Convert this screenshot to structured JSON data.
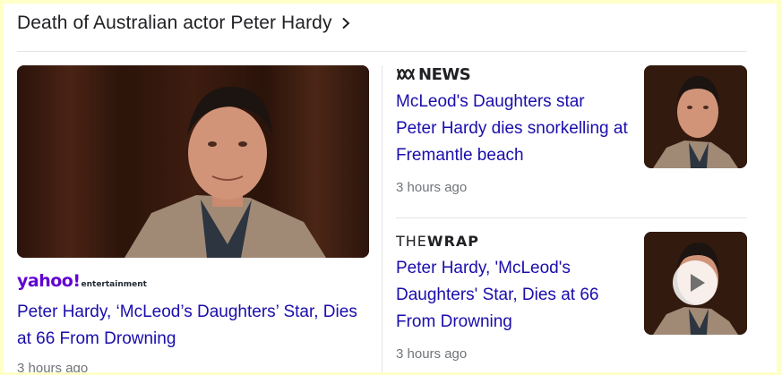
{
  "header": {
    "title": "Death of Australian actor Peter Hardy",
    "chevron_icon": "chevron-right-icon"
  },
  "stories": {
    "main": {
      "source_logo_name": "yahoo-entertainment-logo",
      "source_word": "yahoo!",
      "source_sub": "entertainment",
      "headline": "Peter Hardy, ‘McLeod’s Daughters’ Star, Dies at 66 From Drowning",
      "time": "3 hours ago",
      "image": "peter-hardy-photo"
    },
    "side": [
      {
        "source_logo_name": "abc-news-logo",
        "source_word": "NEWS",
        "headline": "McLeod's Daughters star Peter Hardy dies snorkelling at Fremantle beach",
        "time": "3 hours ago",
        "image": "peter-hardy-thumbnail"
      },
      {
        "source_logo_name": "the-wrap-logo",
        "source_the": "THE",
        "source_wrap": "WRAP",
        "headline": "Peter Hardy, 'McLeod's Daughters' Star, Dies at 66 From Drowning",
        "time": "3 hours ago",
        "image": "peter-hardy-video-thumbnail",
        "play_icon": "play-icon"
      }
    ]
  },
  "colors": {
    "link": "#1a0dab",
    "meta": "#70757a",
    "title": "#202124",
    "yahoo_purple": "#6001d2",
    "frame": "#ffffc8"
  }
}
